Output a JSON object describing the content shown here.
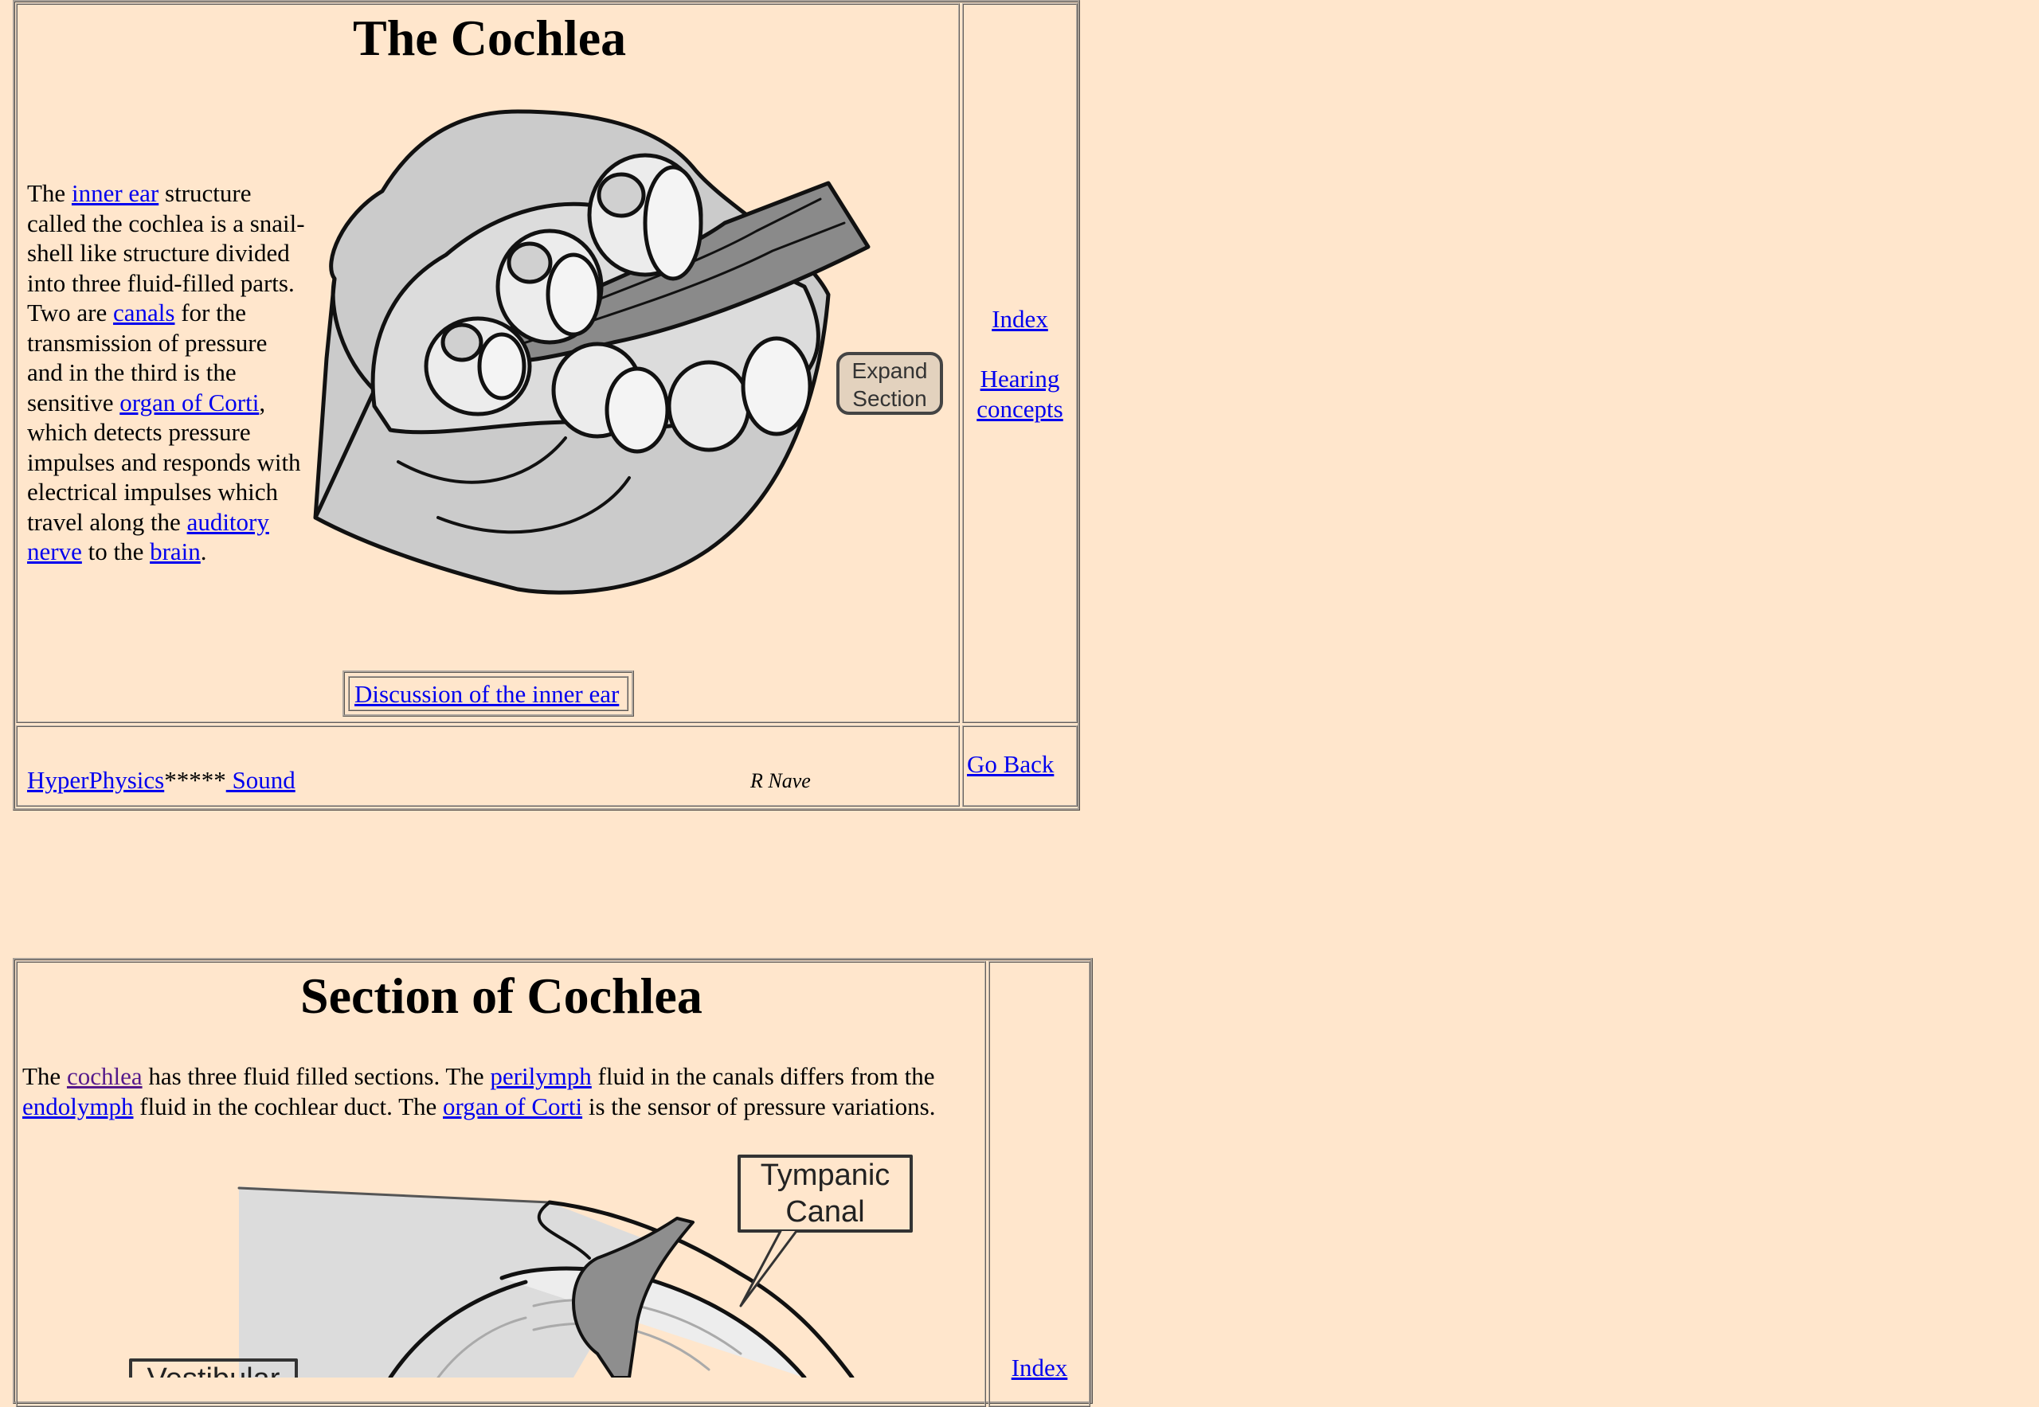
{
  "cochlea": {
    "title": "The Cochlea",
    "desc": {
      "t1": "The ",
      "link_inner_ear": "inner ear",
      "t2": " structure called the cochlea is a snail-shell like structure divided into three fluid-filled parts. Two are ",
      "link_canals": "canals",
      "t3": " for the transmission of pressure and in the third is the sensitive ",
      "link_organ_of_corti": "organ of Corti",
      "t4": ", which detects pressure impulses and responds with electrical impulses which travel along the ",
      "link_auditory_nerve": "auditory nerve",
      "t5": " to the ",
      "link_brain": "brain",
      "t6": "."
    },
    "image_callout": [
      "Expand",
      "Section"
    ],
    "discussion_link": "Discussion of the inner ear"
  },
  "sidebar": {
    "index": "Index",
    "hearing_concepts_line1": "Hearing",
    "hearing_concepts_line2": "concepts",
    "go_back": "Go Back"
  },
  "footer": {
    "hyperphysics": "HyperPhysics",
    "stars": "*****",
    "sound": " Sound",
    "author": "R Nave"
  },
  "section": {
    "title": "Section of Cochlea",
    "desc": {
      "t1": "The ",
      "link_cochlea": "cochlea",
      "t2": " has three fluid filled sections. The ",
      "link_perilymph": "perilymph",
      "t3": " fluid in the canals differs from the ",
      "link_endolymph": "endolymph",
      "t4": " fluid in the cochlear duct. The ",
      "link_organ_of_corti": "organ of Corti",
      "t5": " is the sensor of pressure variations."
    },
    "labels": {
      "tympanic_1": "Tympanic",
      "tympanic_2": "Canal",
      "vestibular": "Vestibular"
    },
    "index": "Index"
  },
  "colors": {
    "background": "#ffe6cc",
    "link": "#0000ee",
    "visited_link": "#551a8b"
  }
}
